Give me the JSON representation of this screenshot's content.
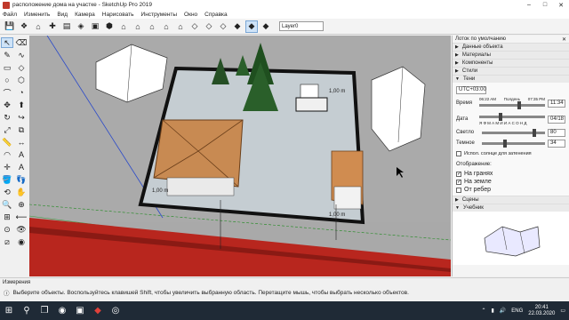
{
  "window": {
    "title": "расположение дома на участке - SketchUp Pro 2019"
  },
  "menu": [
    "Файл",
    "Изменить",
    "Вид",
    "Камера",
    "Нарисовать",
    "Инструменты",
    "Окно",
    "Справка"
  ],
  "toolbar": {
    "layer": "Layer0"
  },
  "tray": {
    "title": "Лоток по умолчанию",
    "sections_top": [
      "Данные объекта",
      "Материалы",
      "Компоненты",
      "Стили",
      "Тени"
    ],
    "shadows": {
      "utc": "UTC+03:00",
      "time_label": "Время",
      "time_start": "06:22 AM",
      "time_mid": "Полдень",
      "time_end": "07:35 PM",
      "time_value": "11:34",
      "date_label": "Дата",
      "months": "Я Ф М А М И И А С О Н Д",
      "date_value": "04/18",
      "light_label": "Светло",
      "light_value": "80",
      "dark_label": "Темное",
      "dark_value": "34",
      "sun_for_shading": "Испол. солнце для затенения",
      "display_label": "Отображение:",
      "on_faces": "На гранях",
      "on_ground": "На земле",
      "from_edges": "От ребер"
    },
    "sections_bottom": [
      "Сцены",
      "Учебник"
    ]
  },
  "status": {
    "measure_label": "Измерения",
    "hint": "Выберите объекты. Воспользуйтесь клавишей Shift, чтобы увеличить выбранную область. Перетащите мышь, чтобы выбрать несколько объектов."
  },
  "taskbar": {
    "lang": "ENG",
    "time": "20:41",
    "date": "22.03.2020"
  },
  "viewport": {
    "dim1": "1,00 m",
    "dim2": "1,00 m",
    "dim3": "1,00 m"
  },
  "colors": {
    "ground": "#a9a9a9",
    "plot": "#c5cdd2",
    "road": "#b8261e",
    "roof": "#c88a52"
  }
}
